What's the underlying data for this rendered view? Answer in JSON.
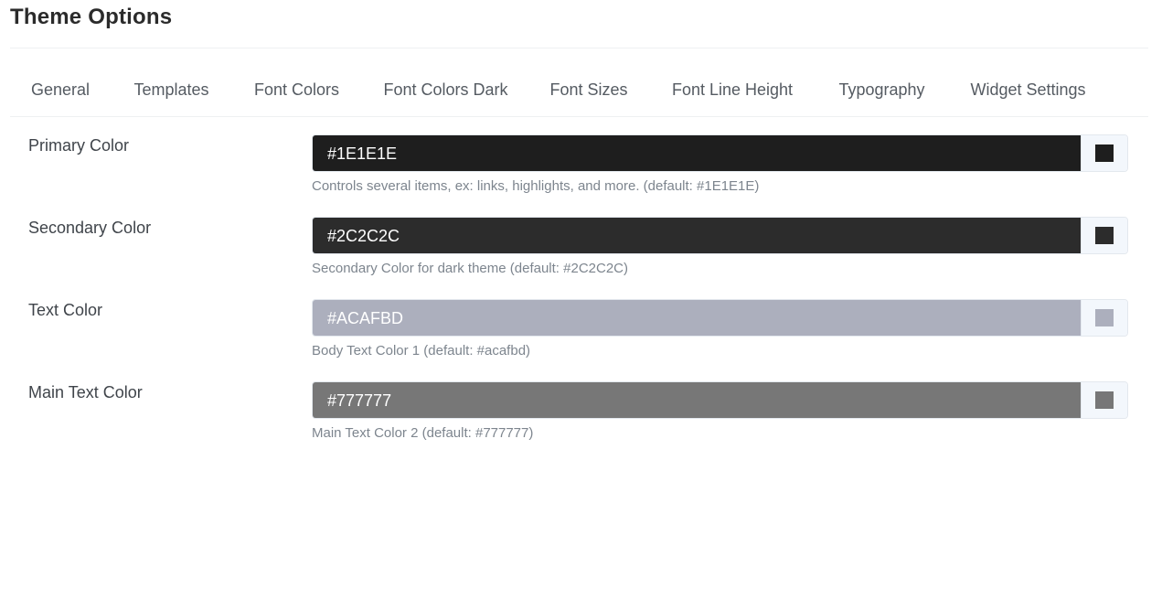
{
  "page": {
    "title": "Theme Options"
  },
  "tabs": [
    {
      "label": "General",
      "active": false
    },
    {
      "label": "Templates",
      "active": true
    },
    {
      "label": "Font Colors",
      "active": false
    },
    {
      "label": "Font Colors Dark",
      "active": true
    },
    {
      "label": "Font Sizes",
      "active": false
    },
    {
      "label": "Font Line Height",
      "active": false
    },
    {
      "label": "Typography",
      "active": false
    },
    {
      "label": "Widget Settings",
      "active": false
    }
  ],
  "accent_color": "#3ebfa8",
  "fields": [
    {
      "label": "Primary Color",
      "value": "#1E1E1E",
      "color": "#1e1e1e",
      "help": "Controls several items, ex: links, highlights, and more. (default: #1E1E1E)"
    },
    {
      "label": "Secondary Color",
      "value": "#2C2C2C",
      "color": "#2c2c2c",
      "help": "Secondary Color for dark theme (default: #2C2C2C)"
    },
    {
      "label": "Text Color",
      "value": "#ACAFBD",
      "color": "#acafbd",
      "help": "Body Text Color 1 (default: #acafbd)"
    },
    {
      "label": "Main Text Color",
      "value": "#777777",
      "color": "#777777",
      "help": "Main Text Color 2 (default: #777777)"
    }
  ]
}
